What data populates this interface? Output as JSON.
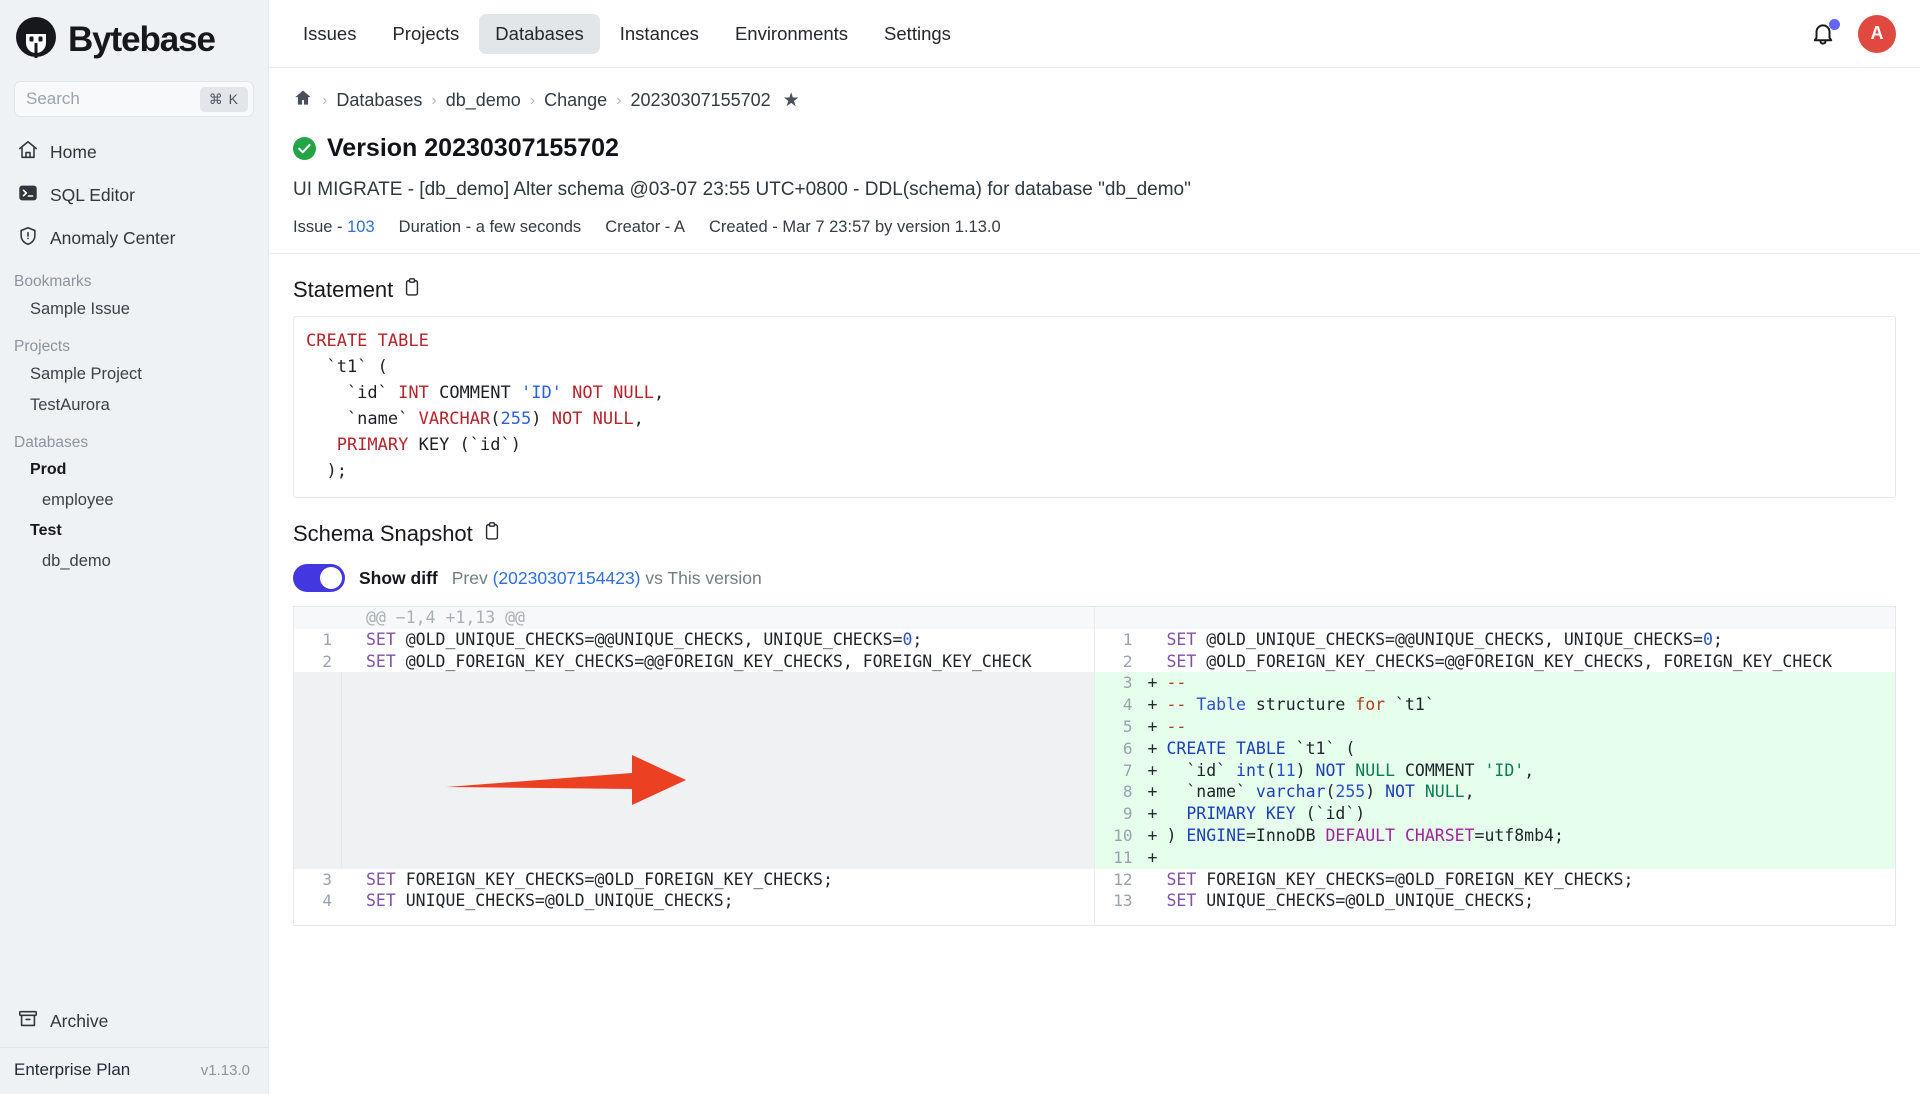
{
  "sidebar": {
    "brand": "Bytebase",
    "search": {
      "placeholder": "Search",
      "kbd": "⌘ K"
    },
    "nav": [
      {
        "label": "Home",
        "icon": "home-icon"
      },
      {
        "label": "SQL Editor",
        "icon": "terminal-icon"
      },
      {
        "label": "Anomaly Center",
        "icon": "shield-alert-icon"
      }
    ],
    "groups": [
      {
        "label": "Bookmarks",
        "items": [
          {
            "label": "Sample Issue",
            "bold": false
          }
        ]
      },
      {
        "label": "Projects",
        "items": [
          {
            "label": "Sample Project",
            "bold": false
          },
          {
            "label": "TestAurora",
            "bold": false
          }
        ]
      },
      {
        "label": "Databases",
        "items": [
          {
            "label": "Prod",
            "bold": true
          },
          {
            "label": "employee",
            "bold": false,
            "indent": true
          },
          {
            "label": "Test",
            "bold": true
          },
          {
            "label": "db_demo",
            "bold": false,
            "indent": true
          }
        ]
      }
    ],
    "archive": "Archive",
    "plan": "Enterprise Plan",
    "version": "v1.13.0"
  },
  "topbar": {
    "tabs": [
      {
        "label": "Issues",
        "active": false
      },
      {
        "label": "Projects",
        "active": false
      },
      {
        "label": "Databases",
        "active": true
      },
      {
        "label": "Instances",
        "active": false
      },
      {
        "label": "Environments",
        "active": false
      },
      {
        "label": "Settings",
        "active": false
      }
    ],
    "bell": "bell-icon",
    "avatar_initial": "A"
  },
  "breadcrumb": {
    "home": "home-icon",
    "items": [
      "Databases",
      "db_demo",
      "Change",
      "20230307155702"
    ],
    "star": "★"
  },
  "page": {
    "title": "Version 20230307155702",
    "status": "success",
    "description": "UI MIGRATE - [db_demo] Alter schema @03-07 23:55 UTC+0800 - DDL(schema) for database \"db_demo\"",
    "meta": {
      "issue_label": "Issue -",
      "issue_value": "103",
      "duration_label": "Duration -",
      "duration_value": "a few seconds",
      "creator_label": "Creator -",
      "creator_value": "A",
      "created_label": "Created -",
      "created_value": "Mar 7 23:57 by version 1.13.0"
    }
  },
  "statement": {
    "title": "Statement",
    "copy_icon": "clipboard-icon",
    "lines": [
      [
        {
          "t": "CREATE TABLE",
          "c": "k"
        }
      ],
      [
        {
          "t": "  `t1` (",
          "c": ""
        }
      ],
      [
        {
          "t": "    `id` ",
          "c": ""
        },
        {
          "t": "INT",
          "c": "k"
        },
        {
          "t": " COMMENT ",
          "c": ""
        },
        {
          "t": "'ID'",
          "c": "str"
        },
        {
          "t": " NOT NULL",
          "c": "k"
        },
        {
          "t": ",",
          "c": ""
        }
      ],
      [
        {
          "t": "    `name` ",
          "c": ""
        },
        {
          "t": "VARCHAR",
          "c": "k"
        },
        {
          "t": "(",
          "c": ""
        },
        {
          "t": "255",
          "c": "num"
        },
        {
          "t": ") ",
          "c": ""
        },
        {
          "t": "NOT NULL",
          "c": "k"
        },
        {
          "t": ",",
          "c": ""
        }
      ],
      [
        {
          "t": "   ",
          "c": ""
        },
        {
          "t": "PRIMARY",
          "c": "k"
        },
        {
          "t": " KEY (`id`)",
          "c": ""
        }
      ],
      [
        {
          "t": "  );",
          "c": ""
        }
      ]
    ]
  },
  "schema_snapshot": {
    "title": "Schema Snapshot",
    "copy_icon": "clipboard-icon",
    "show_diff_label": "Show diff",
    "toggle_on": true,
    "prev_label": "Prev",
    "prev_version": "(20230307154423)",
    "vs_label": "vs This version",
    "hunk_header": "@@ −1,4 +1,13 @@",
    "left_lines": [
      {
        "n": "1",
        "type": "ctx",
        "text": "SET @OLD_UNIQUE_CHECKS=@@UNIQUE_CHECKS, UNIQUE_CHECKS=0;"
      },
      {
        "n": "2",
        "type": "ctx",
        "text": "SET @OLD_FOREIGN_KEY_CHECKS=@@FOREIGN_KEY_CHECKS, FOREIGN_KEY_CHECK"
      },
      {
        "n": "",
        "type": "blank",
        "text": ""
      },
      {
        "n": "",
        "type": "blank",
        "text": ""
      },
      {
        "n": "",
        "type": "blank",
        "text": ""
      },
      {
        "n": "",
        "type": "blank",
        "text": ""
      },
      {
        "n": "",
        "type": "blank",
        "text": ""
      },
      {
        "n": "",
        "type": "blank",
        "text": ""
      },
      {
        "n": "",
        "type": "blank",
        "text": ""
      },
      {
        "n": "",
        "type": "blank",
        "text": ""
      },
      {
        "n": "",
        "type": "blank",
        "text": ""
      },
      {
        "n": "3",
        "type": "ctx",
        "text": "SET FOREIGN_KEY_CHECKS=@OLD_FOREIGN_KEY_CHECKS;"
      },
      {
        "n": "4",
        "type": "ctx",
        "text": "SET UNIQUE_CHECKS=@OLD_UNIQUE_CHECKS;"
      }
    ],
    "right_lines": [
      {
        "n": "1",
        "type": "ctx",
        "sign": "",
        "text": "SET @OLD_UNIQUE_CHECKS=@@UNIQUE_CHECKS, UNIQUE_CHECKS=0;"
      },
      {
        "n": "2",
        "type": "ctx",
        "sign": "",
        "text": "SET @OLD_FOREIGN_KEY_CHECKS=@@FOREIGN_KEY_CHECKS, FOREIGN_KEY_CHECK"
      },
      {
        "n": "3",
        "type": "add",
        "sign": "+",
        "text": "--"
      },
      {
        "n": "4",
        "type": "add",
        "sign": "+",
        "text": "-- Table structure for `t1`"
      },
      {
        "n": "5",
        "type": "add",
        "sign": "+",
        "text": "--"
      },
      {
        "n": "6",
        "type": "add",
        "sign": "+",
        "text": "CREATE TABLE `t1` ("
      },
      {
        "n": "7",
        "type": "add",
        "sign": "+",
        "text": "  `id` int(11) NOT NULL COMMENT 'ID',"
      },
      {
        "n": "8",
        "type": "add",
        "sign": "+",
        "text": "  `name` varchar(255) NOT NULL,"
      },
      {
        "n": "9",
        "type": "add",
        "sign": "+",
        "text": "  PRIMARY KEY (`id`)"
      },
      {
        "n": "10",
        "type": "add",
        "sign": "+",
        "text": ") ENGINE=InnoDB DEFAULT CHARSET=utf8mb4;"
      },
      {
        "n": "11",
        "type": "add",
        "sign": "+",
        "text": ""
      },
      {
        "n": "12",
        "type": "ctx",
        "sign": "",
        "text": "SET FOREIGN_KEY_CHECKS=@OLD_FOREIGN_KEY_CHECKS;"
      },
      {
        "n": "13",
        "type": "ctx",
        "sign": "",
        "text": "SET UNIQUE_CHECKS=@OLD_UNIQUE_CHECKS;"
      }
    ]
  },
  "annotation": {
    "type": "arrow",
    "color": "#ec4023",
    "direction": "right"
  },
  "colors": {
    "accent": "#4338e0",
    "link": "#2f6fdd",
    "success": "#22a447",
    "avatar": "#e0493f",
    "add_bg": "#e6ffec",
    "sidebar_bg": "#eff2f4",
    "arrow": "#ec4023"
  }
}
